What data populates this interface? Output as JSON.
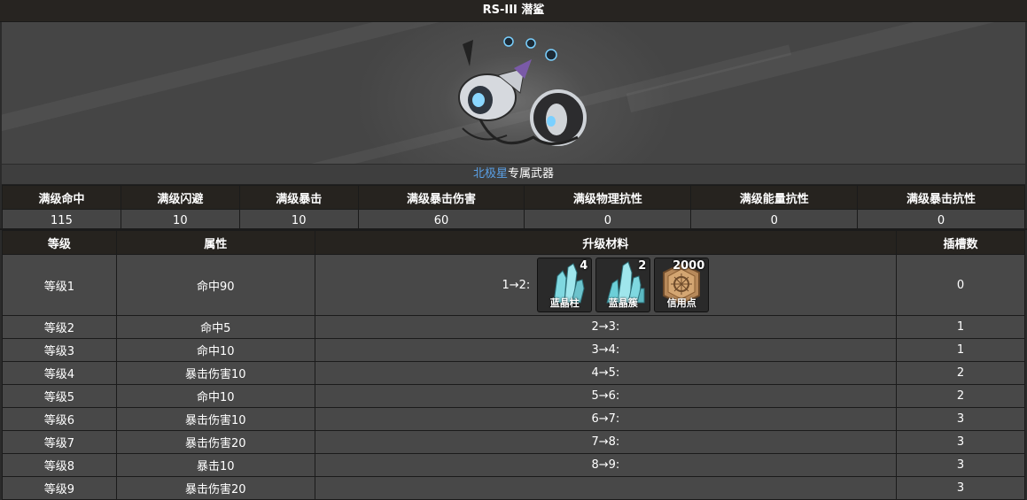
{
  "title": "RS-III 潜鲨",
  "caption": {
    "operator": "北极星",
    "suffix": "专属武器"
  },
  "stats": {
    "headers": [
      "满级命中",
      "满级闪避",
      "满级暴击",
      "满级暴击伤害",
      "满级物理抗性",
      "满级能量抗性",
      "满级暴击抗性"
    ],
    "values": [
      "115",
      "10",
      "10",
      "60",
      "0",
      "0",
      "0"
    ]
  },
  "levels": {
    "headers": [
      "等级",
      "属性",
      "升级材料",
      "插槽数"
    ],
    "rows": [
      {
        "level": "等级1",
        "attr": "命中90",
        "upgrade": "1→2:",
        "slots": "0"
      },
      {
        "level": "等级2",
        "attr": "命中5",
        "upgrade": "2→3:",
        "slots": "1"
      },
      {
        "level": "等级3",
        "attr": "命中10",
        "upgrade": "3→4:",
        "slots": "1"
      },
      {
        "level": "等级4",
        "attr": "暴击伤害10",
        "upgrade": "4→5:",
        "slots": "2"
      },
      {
        "level": "等级5",
        "attr": "命中10",
        "upgrade": "5→6:",
        "slots": "2"
      },
      {
        "level": "等级6",
        "attr": "暴击伤害10",
        "upgrade": "6→7:",
        "slots": "3"
      },
      {
        "level": "等级7",
        "attr": "暴击伤害20",
        "upgrade": "7→8:",
        "slots": "3"
      },
      {
        "level": "等级8",
        "attr": "暴击10",
        "upgrade": "8→9:",
        "slots": "3"
      },
      {
        "level": "等级9",
        "attr": "暴击伤害20",
        "upgrade": "",
        "slots": "3"
      }
    ]
  },
  "materials": [
    {
      "name": "蓝晶柱",
      "qty": "4",
      "icon": "blue-crystal-pillar-icon",
      "color": "#7fd8e0"
    },
    {
      "name": "蓝晶簇",
      "qty": "2",
      "icon": "blue-crystal-cluster-icon",
      "color": "#6ccfd8"
    },
    {
      "name": "信用点",
      "qty": "2000",
      "icon": "credit-coin-icon",
      "color": "#b7895a"
    }
  ],
  "colors": {
    "link": "#5aa0e6",
    "header_bg": "#26231f"
  }
}
